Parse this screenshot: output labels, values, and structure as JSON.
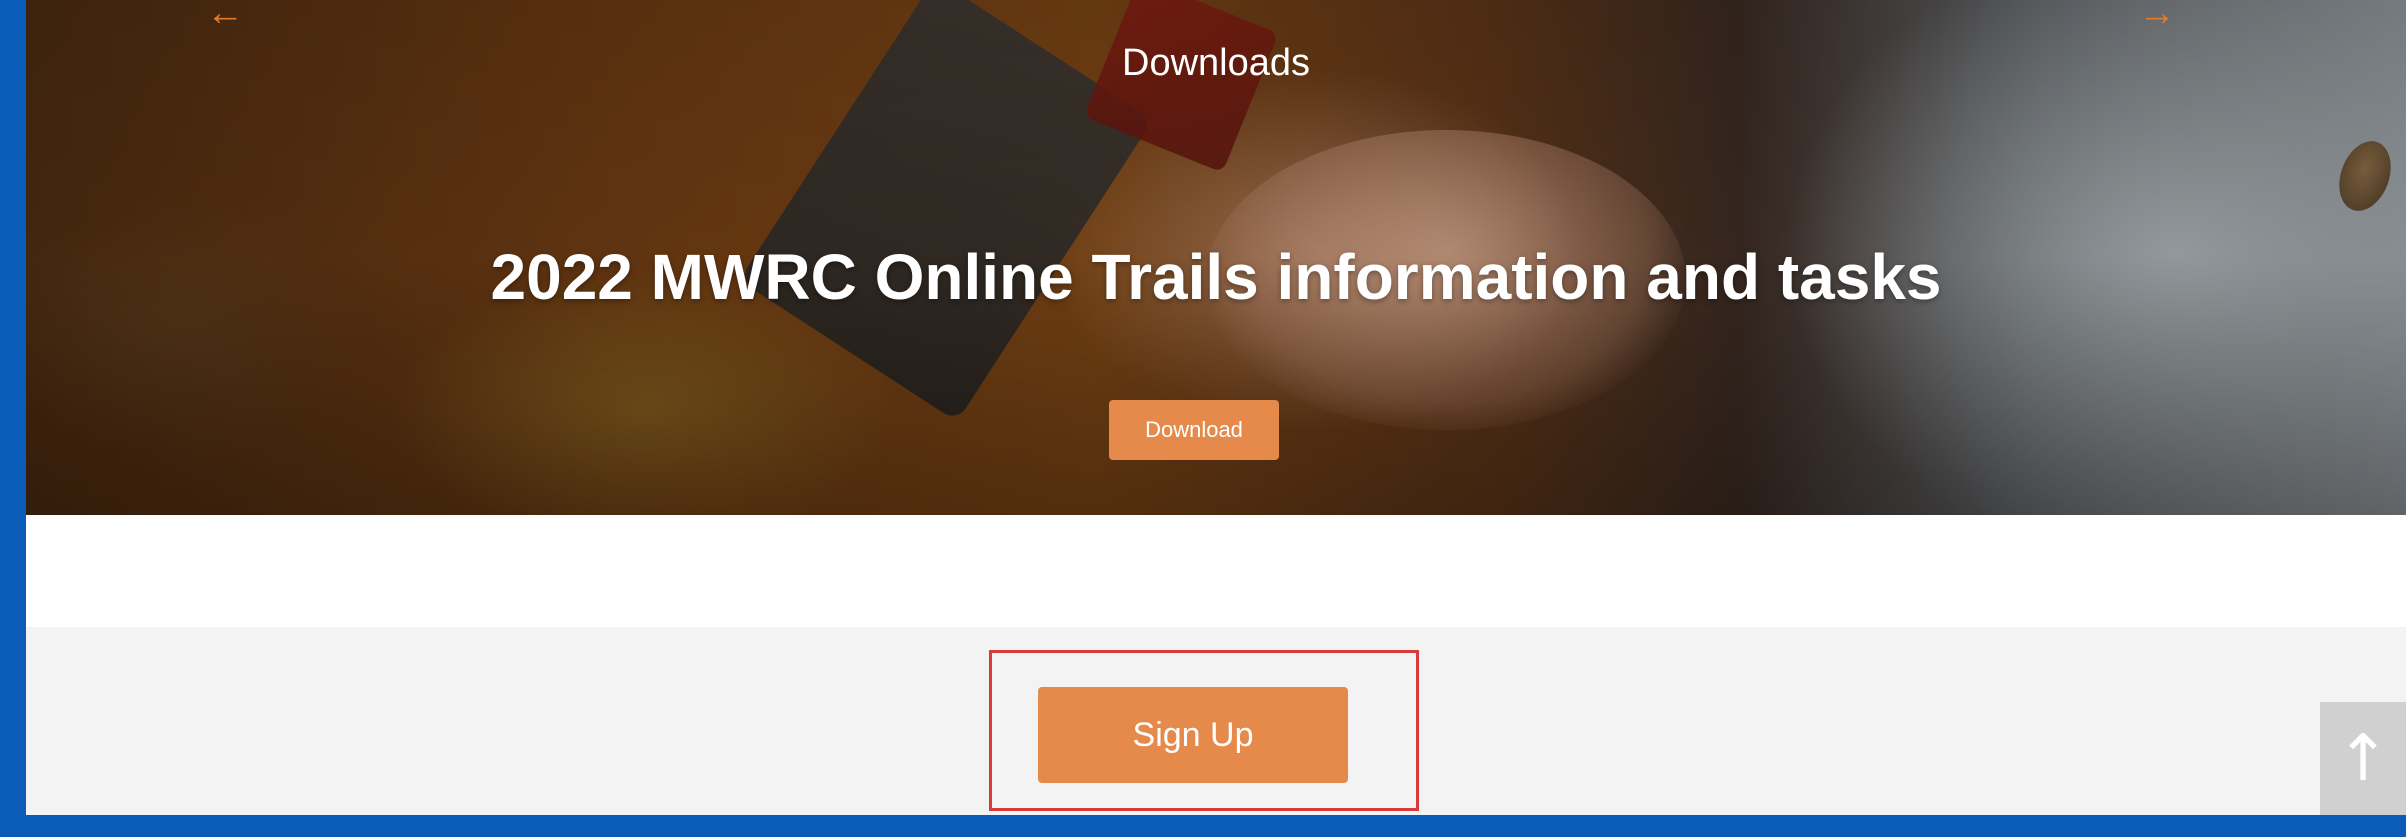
{
  "hero": {
    "kicker": "Downloads",
    "title": "2022 MWRC Online Trails information and tasks",
    "download_label": "Download",
    "prev_arrow": "←",
    "next_arrow": "→"
  },
  "signup": {
    "label": "Sign Up"
  },
  "scroll_top": {
    "icon": "arrow-up-icon",
    "glyph": "↑"
  },
  "colors": {
    "accent": "#e58a4a",
    "highlight": "#d63c3c",
    "frame": "#0a5cb8"
  }
}
